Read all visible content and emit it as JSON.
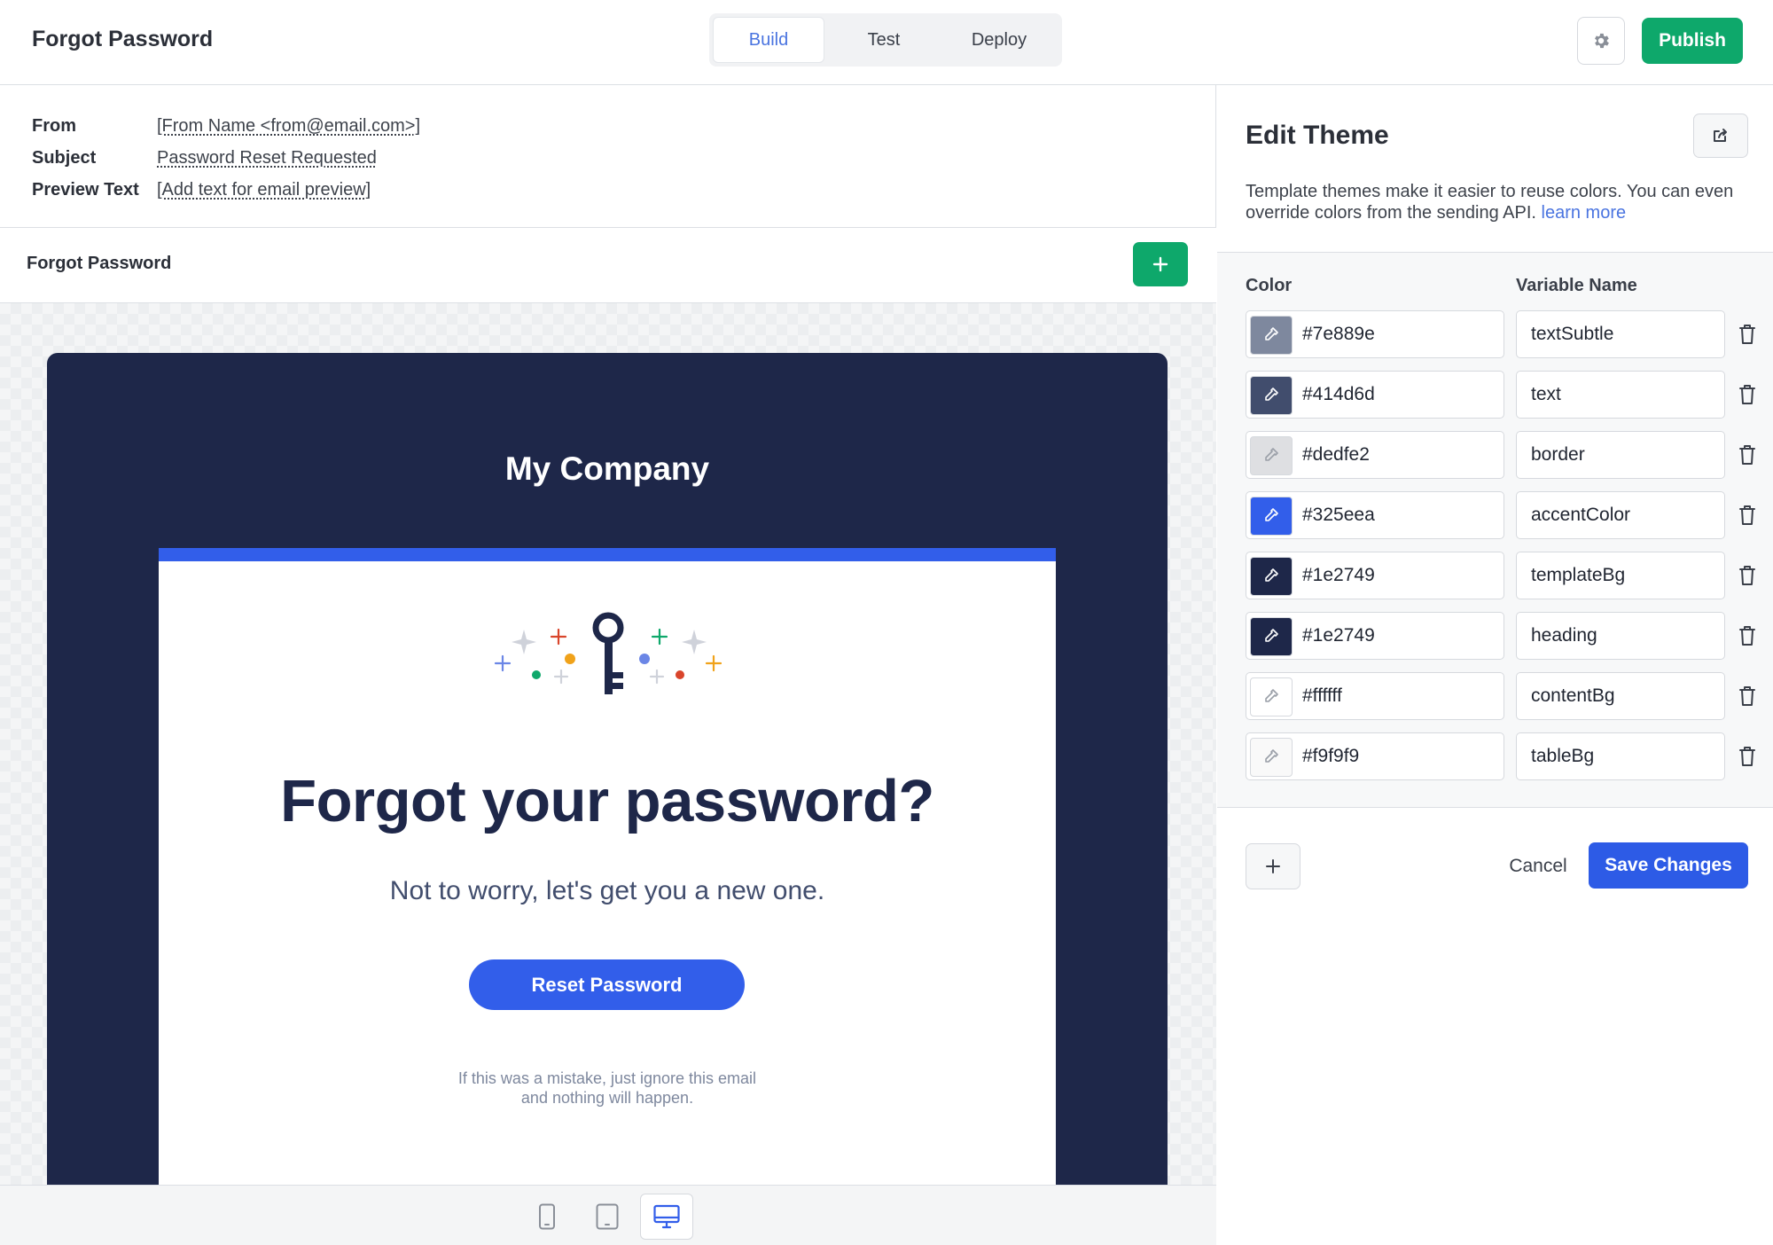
{
  "header": {
    "title": "Forgot Password",
    "tabs": [
      {
        "label": "Build",
        "active": true
      },
      {
        "label": "Test",
        "active": false
      },
      {
        "label": "Deploy",
        "active": false
      }
    ],
    "settings_icon": "gear-icon",
    "publish_label": "Publish"
  },
  "email_meta": {
    "from_label": "From",
    "from_value": "[From Name <from@email.com>]",
    "subject_label": "Subject",
    "subject_value": "Password Reset Requested",
    "preview_label": "Preview Text",
    "preview_value": "[Add text for email preview]"
  },
  "section": {
    "title": "Forgot Password",
    "add_icon": "plus-icon"
  },
  "email": {
    "company": "My Company",
    "hero_icon": "key-sparkles-icon",
    "headline": "Forgot your password?",
    "subline": "Not to worry, let's get you a new one.",
    "button_label": "Reset Password",
    "footnote_line1": "If this was a mistake, just ignore this email",
    "footnote_line2": "and nothing will happen."
  },
  "device_bar": {
    "devices": [
      "mobile-icon",
      "tablet-icon",
      "desktop-icon"
    ],
    "active": "desktop-icon"
  },
  "theme": {
    "title": "Edit Theme",
    "share_icon": "share-icon",
    "description": "Template themes make it easier to reuse colors. You can even override colors from the sending API.",
    "learn_more": "learn more",
    "col_color": "Color",
    "col_variable": "Variable Name",
    "colors": [
      {
        "hex": "#7e889e",
        "name": "textSubtle"
      },
      {
        "hex": "#414d6d",
        "name": "text"
      },
      {
        "hex": "#dedfe2",
        "name": "border"
      },
      {
        "hex": "#325eea",
        "name": "accentColor"
      },
      {
        "hex": "#1e2749",
        "name": "templateBg"
      },
      {
        "hex": "#1e2749",
        "name": "heading"
      },
      {
        "hex": "#ffffff",
        "name": "contentBg"
      },
      {
        "hex": "#f9f9f9",
        "name": "tableBg"
      }
    ],
    "add_icon": "plus-icon",
    "cancel_label": "Cancel",
    "save_label": "Save Changes"
  }
}
